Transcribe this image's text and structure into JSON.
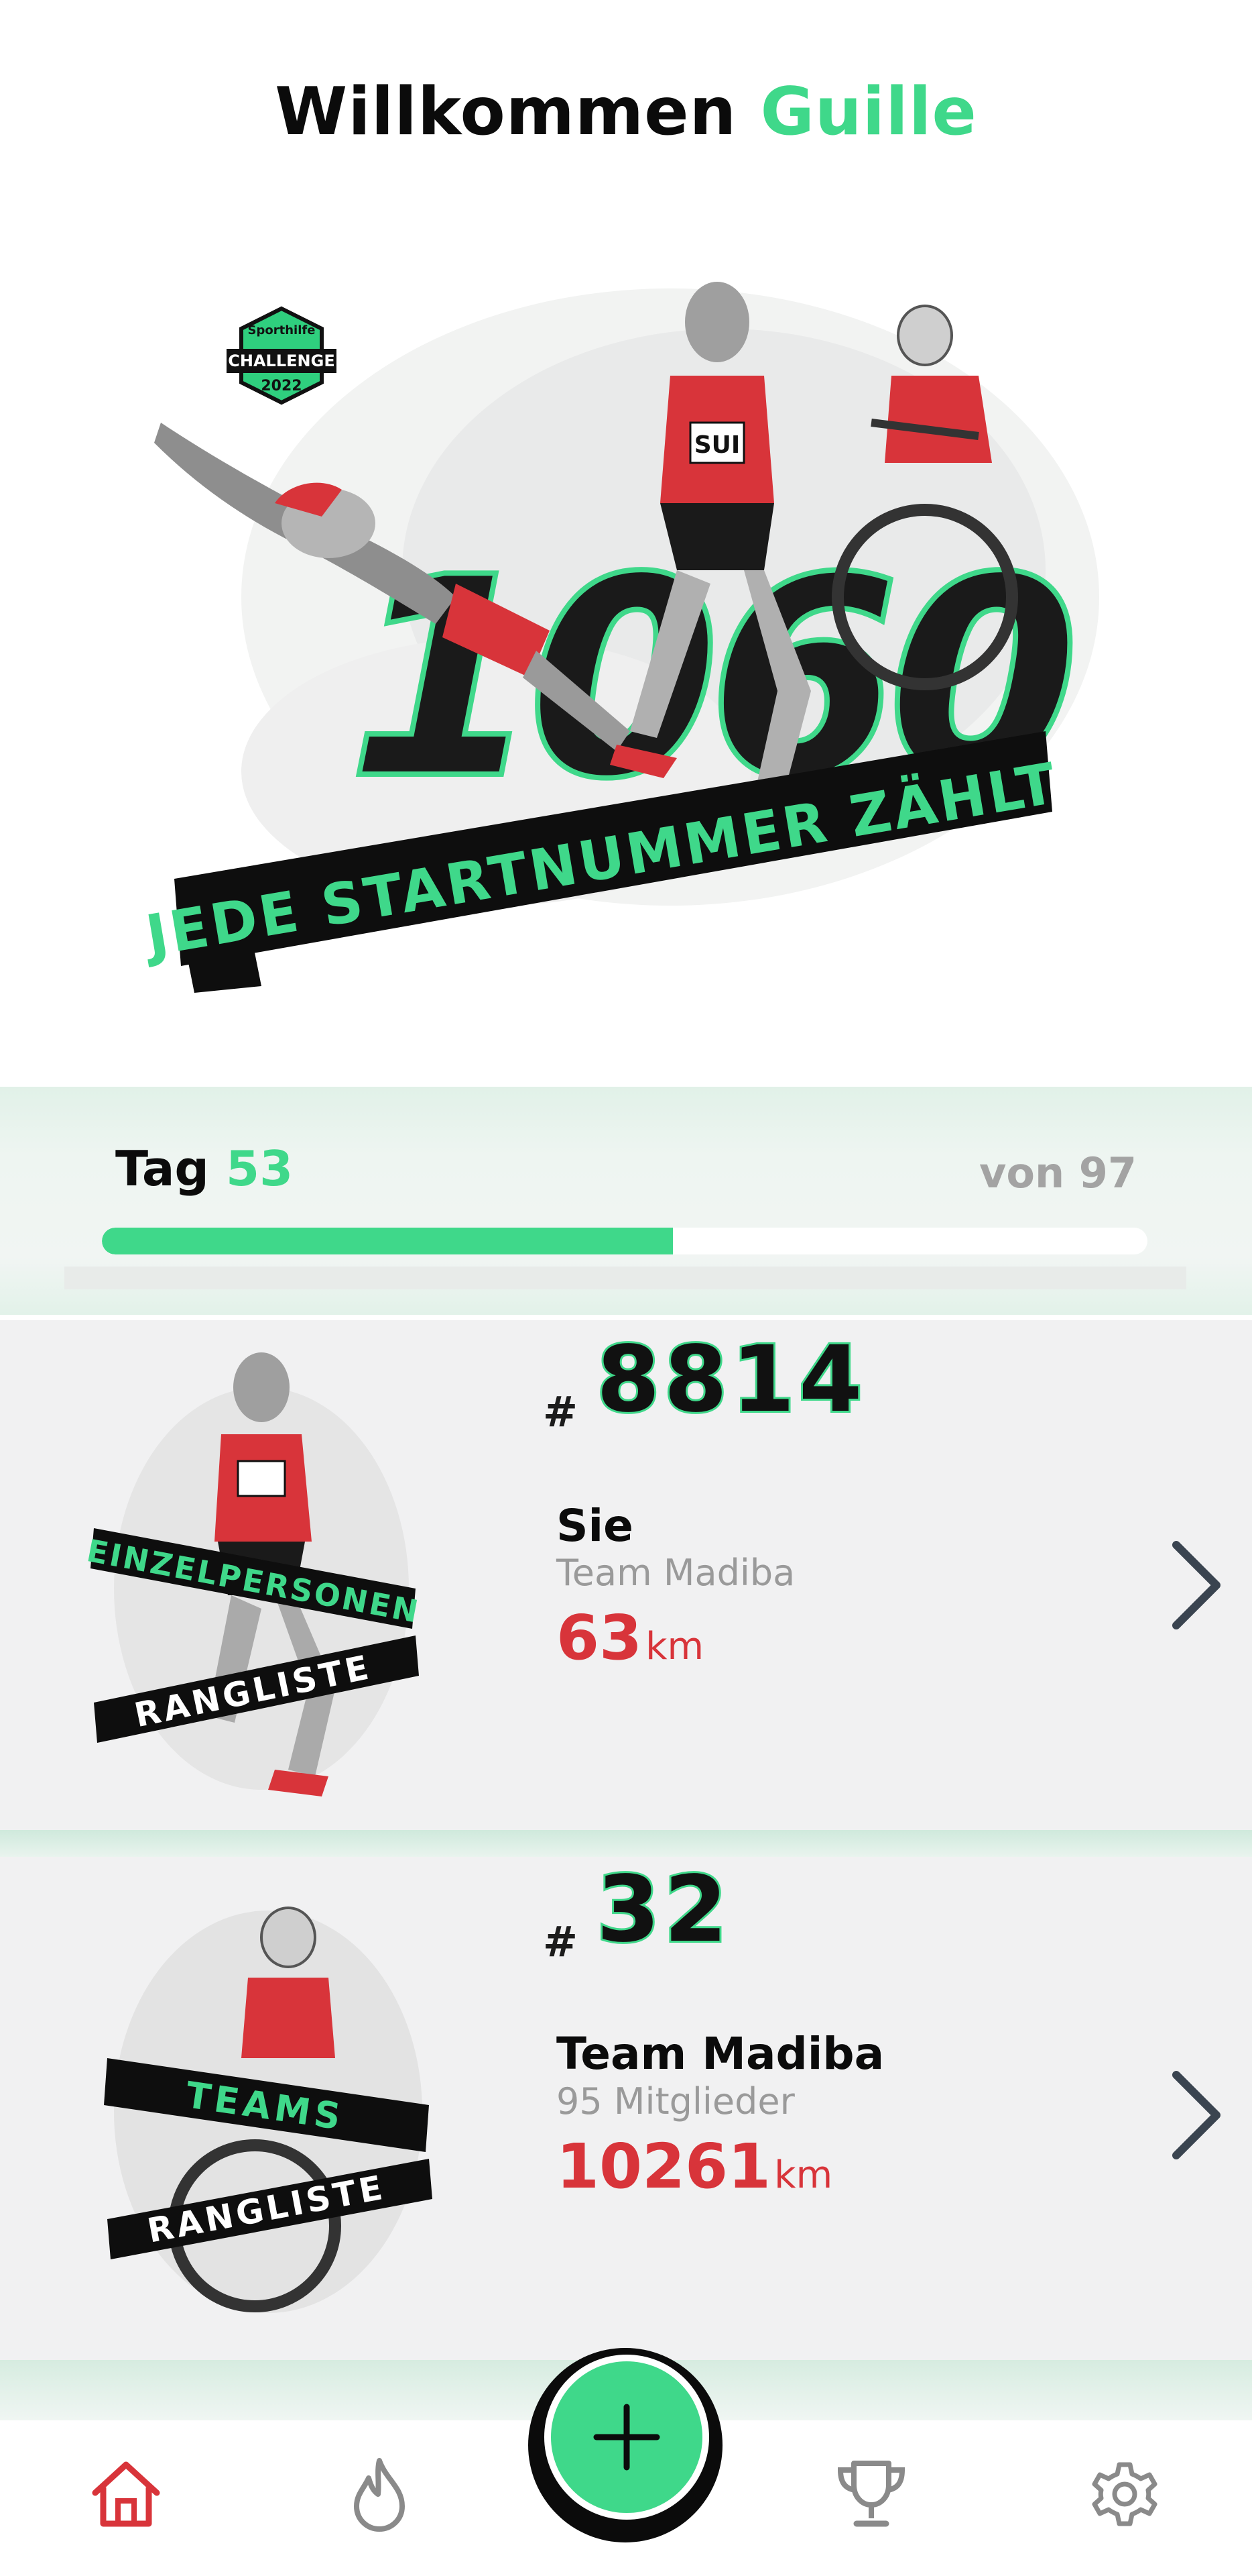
{
  "header": {
    "greeting": "Willkommen",
    "user_name": "Guille"
  },
  "hero": {
    "badge_brand": "Sporthilfe",
    "badge_label": "CHALLENGE",
    "badge_year": "2022",
    "big_number": "1060",
    "banner_text": "JEDE STARTNUMMER ZÄHLT",
    "jersey_text": "SUI"
  },
  "progress": {
    "day_prefix": "Tag",
    "day_current": "53",
    "day_total_text": "von 97",
    "fraction": 0.546
  },
  "individual_card": {
    "image_ribbon_top": "EINZELPERSONEN",
    "image_ribbon_bottom": "RANGLISTE",
    "hash": "#",
    "rank": "8814",
    "name": "Sie",
    "team": "Team Madiba",
    "distance": "63",
    "unit": "km"
  },
  "team_card": {
    "image_ribbon_top": "TEAMS",
    "image_ribbon_bottom": "RANGLISTE",
    "hash": "#",
    "rank": "32",
    "name": "Team Madiba",
    "members": "95 Mitglieder",
    "distance": "10261",
    "unit": "km"
  },
  "nav": {
    "items": [
      "home-icon",
      "flame-icon",
      "trophy-icon",
      "gear-icon"
    ],
    "active": "home"
  },
  "colors": {
    "accent": "#3fd88a",
    "distance_red": "#d8343a",
    "nav_active": "#d8343a",
    "nav_inactive": "#8a8a8a"
  }
}
